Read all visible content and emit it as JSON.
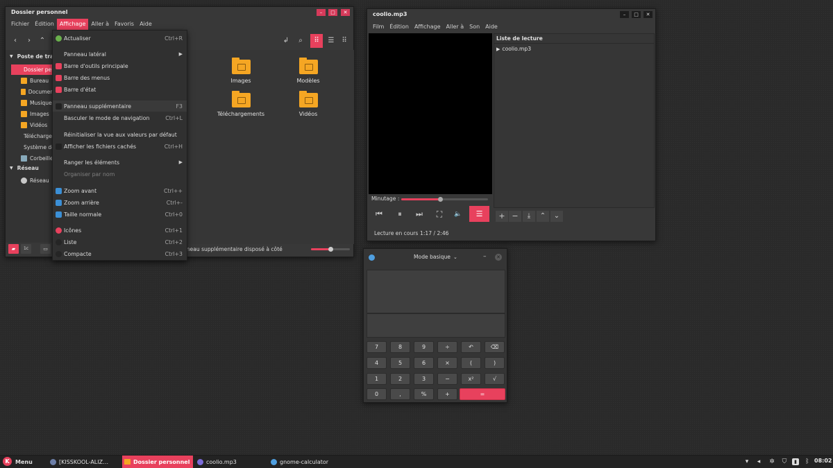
{
  "file_manager": {
    "title": "Dossier personnel",
    "menus": [
      "Fichier",
      "Édition",
      "Affichage",
      "Aller à",
      "Favoris",
      "Aide"
    ],
    "sidebar": {
      "section1": "Poste de travail",
      "items": [
        "Dossier personnel",
        "Bureau",
        "Documents",
        "Musique",
        "Images",
        "Vidéos",
        "Téléchargements",
        "Système de fichiers",
        "Corbeille"
      ],
      "section2": "Réseau",
      "network_items": [
        "Réseau"
      ]
    },
    "folders": [
      "Images",
      "Modèles",
      "Téléchargements",
      "Vidéos"
    ],
    "status_text": "Panneau supplémentaire disposé à côté"
  },
  "view_menu": {
    "items": [
      {
        "label": "Actualiser",
        "shortcut": "Ctrl+R"
      },
      {
        "label": "Panneau latéral",
        "submenu": "▶"
      },
      {
        "label": "Barre d'outils principale"
      },
      {
        "label": "Barre des menus"
      },
      {
        "label": "Barre d'état"
      },
      {
        "label": "Panneau supplémentaire",
        "shortcut": "F3"
      },
      {
        "label": "Basculer le mode de navigation",
        "shortcut": "Ctrl+L"
      },
      {
        "label": "Réinitialiser la vue aux valeurs par défaut"
      },
      {
        "label": "Afficher les fichiers cachés",
        "shortcut": "Ctrl+H"
      },
      {
        "label": "Ranger les éléments",
        "submenu": "▶"
      },
      {
        "label": "Organiser par nom"
      },
      {
        "label": "Zoom avant",
        "shortcut": "Ctrl++"
      },
      {
        "label": "Zoom arrière",
        "shortcut": "Ctrl+-"
      },
      {
        "label": "Taille normale",
        "shortcut": "Ctrl+0"
      },
      {
        "label": "Icônes",
        "shortcut": "Ctrl+1"
      },
      {
        "label": "Liste",
        "shortcut": "Ctrl+2"
      },
      {
        "label": "Compacte",
        "shortcut": "Ctrl+3"
      }
    ]
  },
  "media_player": {
    "title": "coolio.mp3",
    "menus": [
      "Film",
      "Édition",
      "Affichage",
      "Aller à",
      "Son",
      "Aide"
    ],
    "playlist_header": "Liste de lecture",
    "playlist_item": "coolio.mp3",
    "timer_label": "Minutage :",
    "progress": 0.45,
    "status_label": "Lecture en cours",
    "time_display": "1:17 / 2:46"
  },
  "calculator": {
    "mode_label": "Mode basique",
    "rows": [
      [
        "7",
        "8",
        "9",
        "÷",
        "↶",
        "⌫"
      ],
      [
        "4",
        "5",
        "6",
        "×",
        "(",
        ")"
      ],
      [
        "1",
        "2",
        "3",
        "−",
        "x²",
        "√"
      ],
      [
        "0",
        ",",
        "%",
        "+",
        "="
      ]
    ]
  },
  "taskbar": {
    "menu_label": "Menu",
    "tasks": [
      "[KISSKOOL-ALIZ…",
      "Dossier personnel",
      "coolio.mp3",
      "gnome-calculator"
    ],
    "clock": "08:02"
  },
  "colors": {
    "accent": "#e8415d",
    "folder": "#f5a623"
  }
}
